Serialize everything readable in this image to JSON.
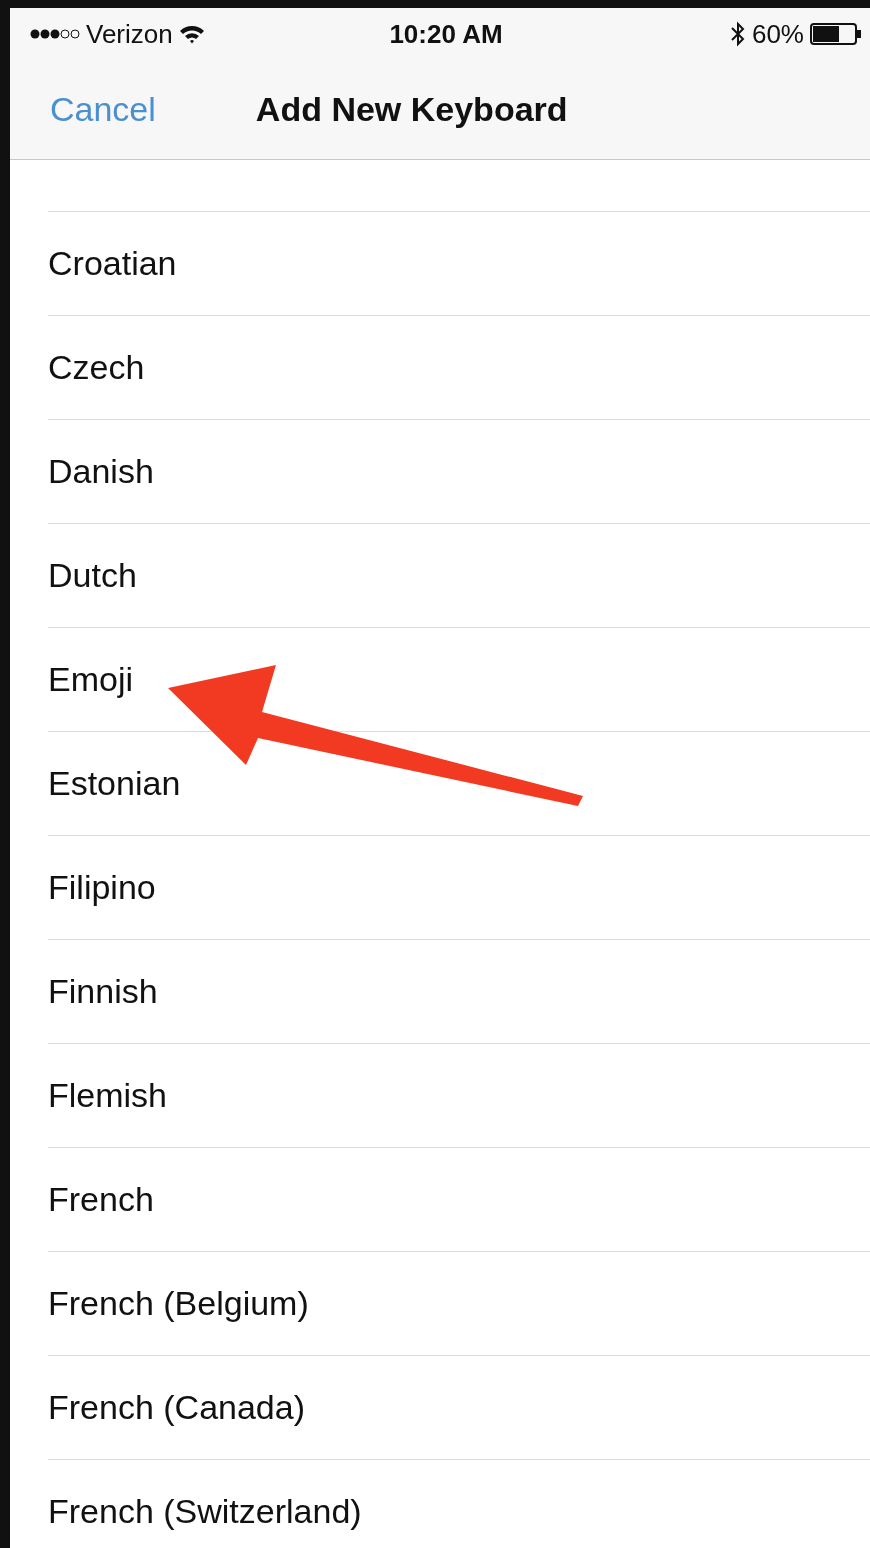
{
  "status_bar": {
    "carrier": "Verizon",
    "time": "10:20 AM",
    "battery": "60%"
  },
  "nav_bar": {
    "cancel": "Cancel",
    "title": "Add New Keyboard"
  },
  "languages": [
    {
      "label": "Croatian"
    },
    {
      "label": "Czech"
    },
    {
      "label": "Danish"
    },
    {
      "label": "Dutch"
    },
    {
      "label": "Emoji"
    },
    {
      "label": "Estonian"
    },
    {
      "label": "Filipino"
    },
    {
      "label": "Finnish"
    },
    {
      "label": "Flemish"
    },
    {
      "label": "French"
    },
    {
      "label": "French (Belgium)"
    },
    {
      "label": "French (Canada)"
    },
    {
      "label": "French (Switzerland)"
    }
  ],
  "annotation": {
    "kind": "arrow"
  }
}
